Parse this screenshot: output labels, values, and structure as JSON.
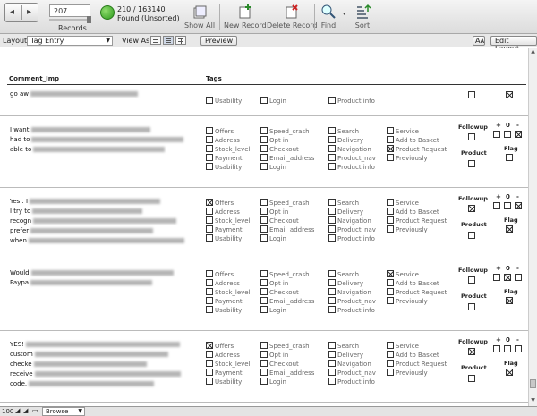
{
  "toolbar": {
    "record_number": "207",
    "records_label": "Records",
    "found_count": "210 / 163140",
    "found_status": "Found (Unsorted)",
    "show_all": "Show All",
    "new_record": "New Record",
    "delete_record": "Delete Record",
    "find": "Find",
    "sort": "Sort"
  },
  "layoutbar": {
    "layout_label": "Layout:",
    "layout_value": "Tag Entry",
    "view_as_label": "View As:",
    "preview": "Preview",
    "aa": "Aᴀ",
    "edit_layout": "Edit Layout"
  },
  "headers": {
    "comment": "Comment_Imp",
    "tags": "Tags"
  },
  "tag_columns": [
    [
      "Offers",
      "Address",
      "Stock_level",
      "Payment",
      "Usability"
    ],
    [
      "Speed_crash",
      "Opt in",
      "Checkout",
      "Email_address",
      "Login"
    ],
    [
      "Search",
      "Delivery",
      "Navigation",
      "Product_nav",
      "Product info"
    ],
    [
      "Service",
      "Add to Basket",
      "Product Request",
      "Previously"
    ]
  ],
  "side": {
    "followup": "Followup",
    "product": "Product",
    "flag": "Flag",
    "plus": "+",
    "zero": "0",
    "minus": "-"
  },
  "records": [
    {
      "lines": [
        "go aw"
      ],
      "checked": [
        [
          4,
          0
        ]
      ],
      "followup_x": false,
      "flag_x": true,
      "pm": [
        false,
        false,
        false
      ],
      "partial": true
    },
    {
      "lines": [
        "I want",
        "had to",
        "able to"
      ],
      "checked": [
        [
          3,
          2
        ]
      ],
      "followup_x": false,
      "flag_x": false,
      "pm": [
        false,
        false,
        true
      ],
      "partial": false
    },
    {
      "lines": [
        "Yes . I",
        "I try to",
        "recogn",
        "prefer",
        "when"
      ],
      "checked": [
        [
          0,
          0
        ]
      ],
      "followup_x": true,
      "flag_x": true,
      "pm": [
        false,
        false,
        true
      ],
      "partial": false
    },
    {
      "lines": [
        "Would",
        "Paypa"
      ],
      "checked": [
        [
          3,
          0
        ]
      ],
      "followup_x": false,
      "flag_x": true,
      "pm": [
        false,
        true,
        false
      ],
      "partial": false
    },
    {
      "lines": [
        "YES!",
        "custom",
        "checke",
        "receive",
        "code."
      ],
      "checked": [
        [
          0,
          0
        ]
      ],
      "followup_x": true,
      "flag_x": true,
      "pm": [
        false,
        false,
        false
      ],
      "partial": false
    }
  ],
  "statusbar": {
    "zoom": "100",
    "mode": "Browse"
  }
}
